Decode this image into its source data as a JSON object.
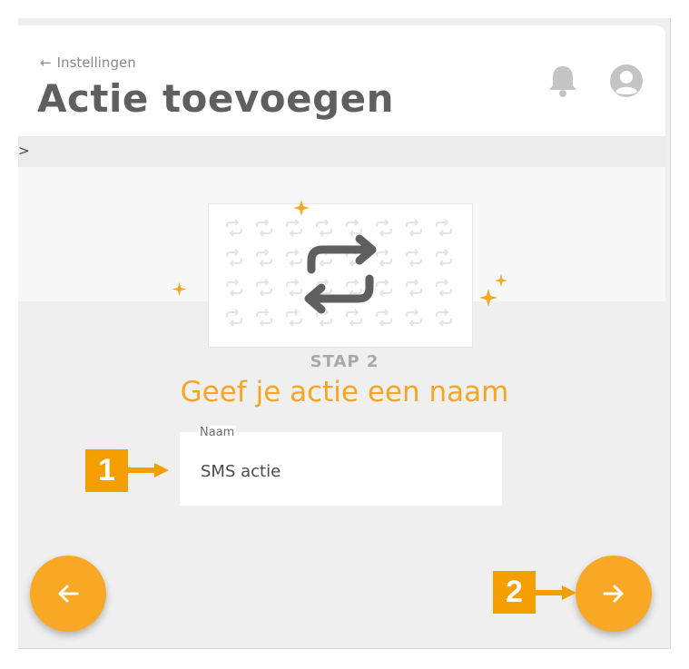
{
  "header": {
    "back_arrow": "←",
    "back_label": "Instellingen",
    "title": "Actie toevoegen",
    "icons": [
      "bell-icon",
      "user-avatar-icon"
    ]
  },
  "breadcrumb": {
    "text": ">"
  },
  "wizard": {
    "illustration_icon": "repeat-icon",
    "step_label": "STAP 2",
    "step_title": "Geef je actie een naam",
    "name_field": {
      "label": "Naam",
      "value": "SMS actie"
    }
  },
  "navigation": {
    "prev_icon": "arrow-left-icon",
    "next_icon": "arrow-right-icon"
  },
  "callouts": [
    {
      "number": "1"
    },
    {
      "number": "2"
    }
  ],
  "colors": {
    "accent": "#f9a825",
    "callout": "#f59e00",
    "title": "#5f5f5f",
    "step_title": "#f5a623"
  }
}
